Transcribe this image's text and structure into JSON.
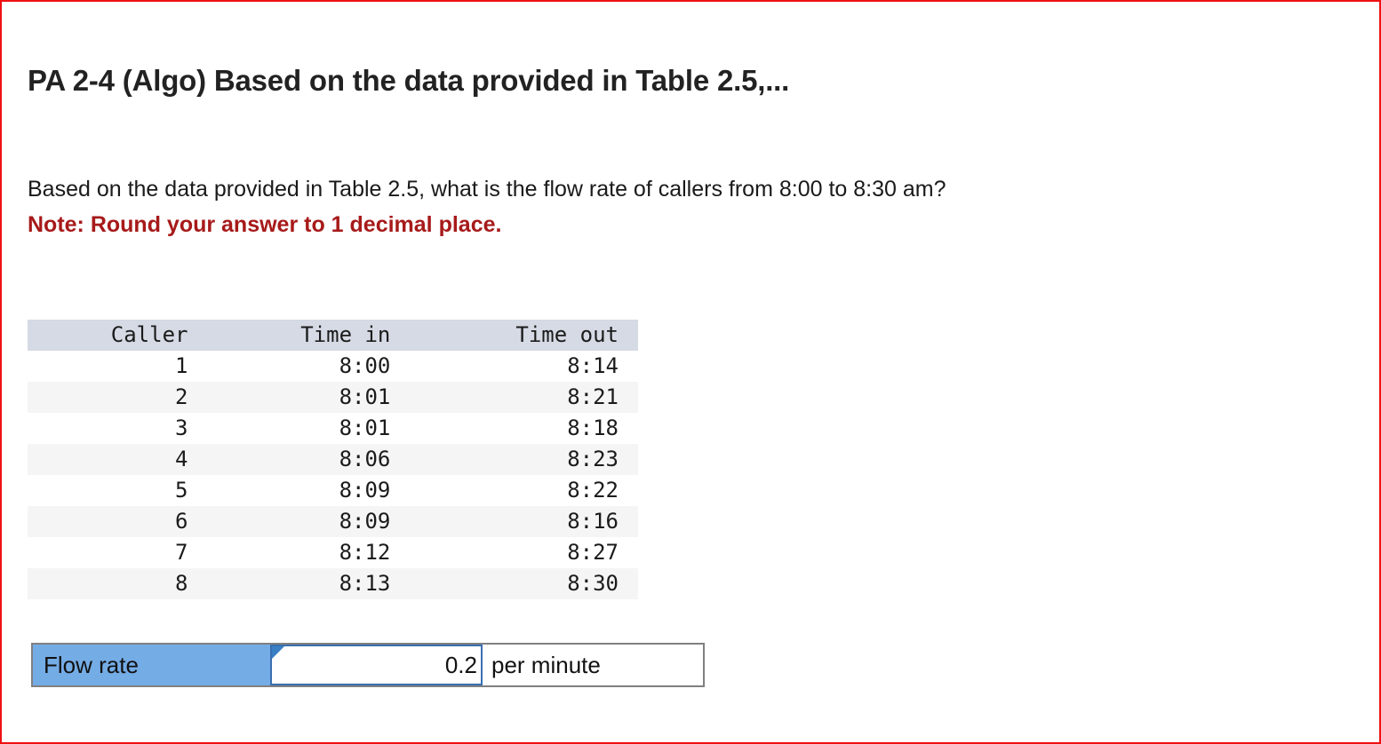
{
  "question": {
    "title": "PA 2-4 (Algo) Based on the data provided in Table 2.5,...",
    "prompt": "Based on the data provided in Table 2.5, what is the flow rate of callers from 8:00 to 8:30 am?",
    "note": "Note: Round your answer to 1 decimal place.",
    "note_color": "#a71a1a"
  },
  "table": {
    "headers": [
      "Caller",
      "Time in",
      "Time out"
    ],
    "rows": [
      [
        "1",
        "8:00",
        "8:14"
      ],
      [
        "2",
        "8:01",
        "8:21"
      ],
      [
        "3",
        "8:01",
        "8:18"
      ],
      [
        "4",
        "8:06",
        "8:23"
      ],
      [
        "5",
        "8:09",
        "8:22"
      ],
      [
        "6",
        "8:09",
        "8:16"
      ],
      [
        "7",
        "8:12",
        "8:27"
      ],
      [
        "8",
        "8:13",
        "8:30"
      ]
    ],
    "header_background": "#d5dae4",
    "stripe_background": "#f5f5f5"
  },
  "answer": {
    "label": "Flow rate",
    "value": "0.2",
    "placeholder": "",
    "unit": "per minute",
    "label_background": "#74ace6",
    "input_border": "#3a6fb0"
  },
  "page": {
    "border_color": "#ee1111"
  }
}
